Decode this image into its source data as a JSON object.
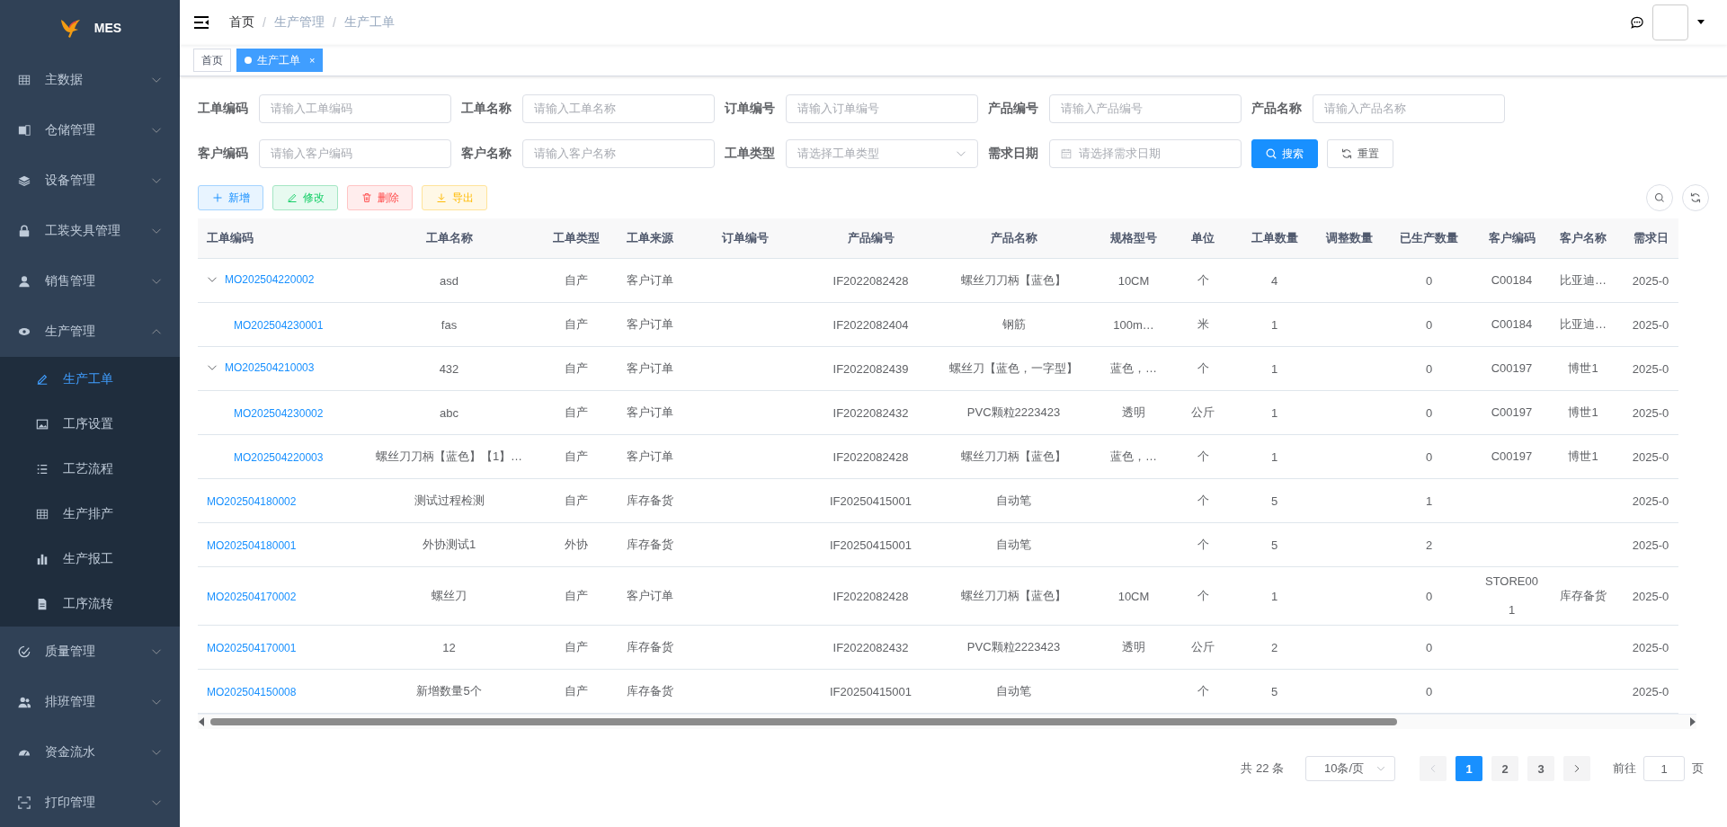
{
  "sidebar": {
    "title": "MES",
    "items": [
      {
        "label": "主数据",
        "expanded": false
      },
      {
        "label": "仓储管理",
        "expanded": false
      },
      {
        "label": "设备管理",
        "expanded": false
      },
      {
        "label": "工装夹具管理",
        "expanded": false
      },
      {
        "label": "销售管理",
        "expanded": false
      },
      {
        "label": "生产管理",
        "expanded": true,
        "children": [
          {
            "label": "生产工单",
            "selected": true
          },
          {
            "label": "工序设置",
            "selected": false
          },
          {
            "label": "工艺流程",
            "selected": false
          },
          {
            "label": "生产排产",
            "selected": false
          },
          {
            "label": "生产报工",
            "selected": false
          },
          {
            "label": "工序流转",
            "selected": false
          }
        ]
      },
      {
        "label": "质量管理",
        "expanded": false
      },
      {
        "label": "排班管理",
        "expanded": false
      },
      {
        "label": "资金流水",
        "expanded": false
      },
      {
        "label": "打印管理",
        "expanded": false
      }
    ]
  },
  "breadcrumb": {
    "separator": "/",
    "items": [
      {
        "label": "首页",
        "link": true
      },
      {
        "label": "生产管理",
        "link": false
      },
      {
        "label": "生产工单",
        "link": false
      }
    ]
  },
  "tags": [
    {
      "label": "首页",
      "selected": false
    },
    {
      "label": "生产工单",
      "selected": true,
      "close": "×"
    }
  ],
  "filters": [
    {
      "label": "工单编码",
      "kind": "input",
      "placeholder": "请输入工单编码"
    },
    {
      "label": "工单名称",
      "kind": "input",
      "placeholder": "请输入工单名称"
    },
    {
      "label": "订单编号",
      "kind": "input",
      "placeholder": "请输入订单编号"
    },
    {
      "label": "产品编号",
      "kind": "input",
      "placeholder": "请输入产品编号"
    },
    {
      "label": "产品名称",
      "kind": "input",
      "placeholder": "请输入产品名称"
    },
    {
      "label": "客户编码",
      "kind": "input",
      "placeholder": "请输入客户编码"
    },
    {
      "label": "客户名称",
      "kind": "input",
      "placeholder": "请输入客户名称"
    },
    {
      "label": "工单类型",
      "kind": "select",
      "placeholder": "请选择工单类型"
    },
    {
      "label": "需求日期",
      "kind": "date",
      "placeholder": "请选择需求日期"
    }
  ],
  "filter_buttons": [
    {
      "label": "搜索",
      "kind": "primary"
    },
    {
      "label": "重置",
      "kind": "default"
    }
  ],
  "actions": [
    {
      "label": "新增",
      "kind": "primary"
    },
    {
      "label": "修改",
      "kind": "success"
    },
    {
      "label": "删除",
      "kind": "danger"
    },
    {
      "label": "导出",
      "kind": "warning"
    }
  ],
  "table": {
    "columns": [
      "工单编码",
      "工单名称",
      "工单类型",
      "工单来源",
      "订单编号",
      "产品编号",
      "产品名称",
      "规格型号",
      "单位",
      "工单数量",
      "调整数量",
      "已生产数量",
      "客户编码",
      "客户名称",
      "需求日"
    ],
    "rows": [
      {
        "code": "MO202504220002",
        "name": "asd",
        "type": "自产",
        "source": "客户订单",
        "product_code": "IF2022082428",
        "product_name": "螺丝刀刀柄【蓝色】",
        "spec": "10CM",
        "unit": "个",
        "quantity": "4",
        "produced": "0",
        "customer_code": "C00184",
        "customer_name": "比亚迪…",
        "due_date": "2025-0",
        "expanded": true,
        "children": [
          {
            "code": "MO202504230001",
            "name": "fas",
            "type": "自产",
            "source": "客户订单",
            "product_code": "IF2022082404",
            "product_name": "钢筋",
            "spec": "100m…",
            "unit": "米",
            "quantity": "1",
            "produced": "0",
            "customer_code": "C00184",
            "customer_name": "比亚迪…",
            "due_date": "2025-0"
          }
        ]
      },
      {
        "code": "MO202504210003",
        "name": "432",
        "type": "自产",
        "source": "客户订单",
        "product_code": "IF2022082439",
        "product_name": "螺丝刀【蓝色，一字型】",
        "spec": "蓝色，…",
        "unit": "个",
        "quantity": "1",
        "produced": "0",
        "customer_code": "C00197",
        "customer_name": "博世1",
        "due_date": "2025-0",
        "expanded": true,
        "children": [
          {
            "code": "MO202504230002",
            "name": "abc",
            "type": "自产",
            "source": "客户订单",
            "product_code": "IF2022082432",
            "product_name": "PVC颗粒2223423",
            "spec": "透明",
            "unit": "公斤",
            "quantity": "1",
            "produced": "0",
            "customer_code": "C00197",
            "customer_name": "博世1",
            "due_date": "2025-0"
          },
          {
            "code": "MO202504220003",
            "name": "螺丝刀刀柄【蓝色】【1】…",
            "type": "自产",
            "source": "客户订单",
            "product_code": "IF2022082428",
            "product_name": "螺丝刀刀柄【蓝色】",
            "spec": "蓝色，…",
            "unit": "个",
            "quantity": "1",
            "produced": "0",
            "customer_code": "C00197",
            "customer_name": "博世1",
            "due_date": "2025-0"
          }
        ]
      },
      {
        "code": "MO202504180002",
        "name": "测试过程检测",
        "type": "自产",
        "source": "库存备货",
        "product_code": "IF20250415001",
        "product_name": "自动笔",
        "unit": "个",
        "quantity": "5",
        "produced": "1",
        "due_date": "2025-0"
      },
      {
        "code": "MO202504180001",
        "name": "外协测试1",
        "type": "外协",
        "source": "库存备货",
        "product_code": "IF20250415001",
        "product_name": "自动笔",
        "unit": "个",
        "quantity": "5",
        "produced": "2",
        "due_date": "2025-0"
      },
      {
        "code": "MO202504170002",
        "name": "螺丝刀",
        "type": "自产",
        "source": "客户订单",
        "product_code": "IF2022082428",
        "product_name": "螺丝刀刀柄【蓝色】",
        "spec": "10CM",
        "unit": "个",
        "quantity": "1",
        "produced": "0",
        "customer_code": "STORE001",
        "customer_name": "库存备货",
        "due_date": "2025-0"
      },
      {
        "code": "MO202504170001",
        "name": "12",
        "type": "自产",
        "source": "库存备货",
        "product_code": "IF2022082432",
        "product_name": "PVC颗粒2223423",
        "spec": "透明",
        "unit": "公斤",
        "quantity": "2",
        "produced": "0",
        "due_date": "2025-0"
      },
      {
        "code": "MO202504150008",
        "name": "新增数量5个",
        "type": "自产",
        "source": "库存备货",
        "product_code": "IF20250415001",
        "product_name": "自动笔",
        "unit": "个",
        "quantity": "5",
        "produced": "0",
        "due_date": "2025-0"
      }
    ]
  },
  "pagination": {
    "total": "共 22 条",
    "page_size": "10条/页",
    "pages": [
      {
        "label": "1",
        "selected": true
      },
      {
        "label": "2",
        "selected": false
      },
      {
        "label": "3",
        "selected": false
      }
    ],
    "goto_label": "前往",
    "goto_value": "1",
    "page_suffix": "页"
  }
}
